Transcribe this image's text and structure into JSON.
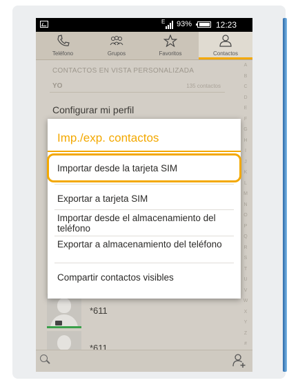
{
  "status_bar": {
    "signal_label": "E",
    "battery_percent": "93%",
    "battery_level": 0.93,
    "time": "12:23"
  },
  "tabs": [
    {
      "label": "Teléfono",
      "icon": "phone-icon",
      "active": false
    },
    {
      "label": "Grupos",
      "icon": "group-icon",
      "active": false
    },
    {
      "label": "Favoritos",
      "icon": "star-icon",
      "active": false
    },
    {
      "label": "Contactos",
      "icon": "person-icon",
      "active": true
    }
  ],
  "contacts_view": {
    "section_header": "CONTACTOS EN VISTA PERSONALIZADA",
    "yo_label": "YO",
    "contact_count": "135 contactos",
    "configure_profile": "Configurar mi perfil",
    "alphabet": [
      "A",
      "B",
      "C",
      "D",
      "E",
      "F",
      "G",
      "H",
      "I",
      "J",
      "K",
      "L",
      "M",
      "N",
      "O",
      "P",
      "Q",
      "R",
      "S",
      "T",
      "U",
      "V",
      "W",
      "X",
      "Y",
      "Z",
      "#"
    ],
    "contacts": [
      {
        "name": "*611"
      },
      {
        "name": "*611"
      }
    ]
  },
  "dialog": {
    "title": "Imp./exp. contactos",
    "options": [
      "Importar desde la tarjeta SIM",
      "Exportar a tarjeta SIM",
      "Importar desde el almacenamiento del teléfono",
      "Exportar a almacenamiento del teléfono",
      "Compartir contactos visibles"
    ],
    "highlighted_index": 0
  },
  "bottom_bar": {
    "search_icon": "search-icon",
    "add_icon": "add-contact-icon"
  },
  "colors": {
    "accent": "#f3a800",
    "status_bar": "#000000",
    "frame_background": "#eceef0"
  }
}
